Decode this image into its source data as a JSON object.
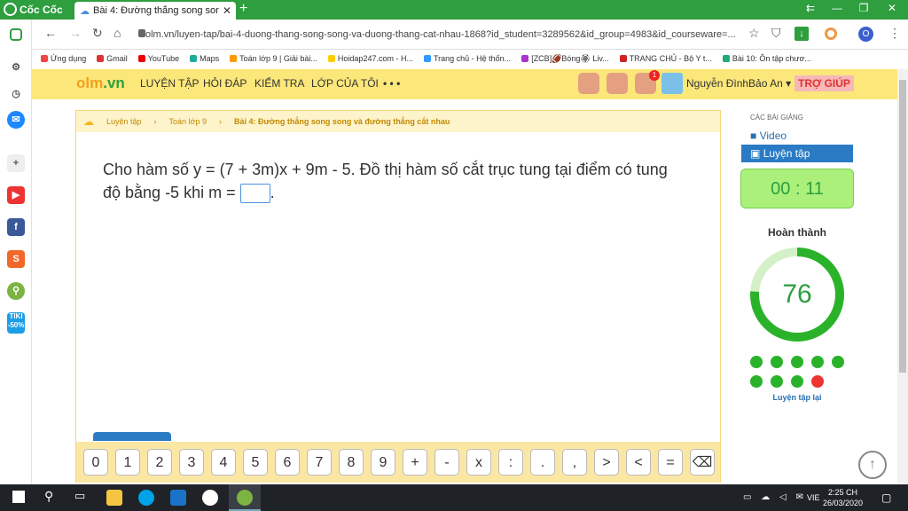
{
  "browser": {
    "app_name": "Cốc Cốc",
    "tab_title": "Bài 4: Đường thẳng song song",
    "url": "olm.vn/luyen-tap/bai-4-duong-thang-song-song-va-duong-thang-cat-nhau-1868?id_student=3289562&id_group=4983&id_courseware=...",
    "profile_initial": "O"
  },
  "bookmarks": [
    {
      "label": "Ứng dụng",
      "color": "#e44"
    },
    {
      "label": "Gmail",
      "color": "#d33"
    },
    {
      "label": "YouTube",
      "color": "#e00"
    },
    {
      "label": "Maps",
      "color": "#2a9"
    },
    {
      "label": "Toán lớp 9 | Giải bài...",
      "color": "#f90"
    },
    {
      "label": "Hoidap247.com - H...",
      "color": "#fc0"
    },
    {
      "label": "Trang chủ - Hệ thốn...",
      "color": "#39f"
    },
    {
      "label": "[ZCB]🏈Bóng🏵 Liv...",
      "color": "#a3c"
    },
    {
      "label": "TRANG CHỦ - Bộ Y t...",
      "color": "#c22"
    },
    {
      "label": "Bài 10: Ôn tập chươ...",
      "color": "#2a7"
    }
  ],
  "site": {
    "logo_main": "olm",
    "logo_suffix": ".vn",
    "menu": [
      "LUYỆN TẬP",
      "HỎI ĐÁP",
      "KIỂM TRA",
      "LỚP CỦA TÔI",
      "• • •"
    ],
    "notif_count": "1",
    "user_name": "Nguyễn ĐìnhBảo An ▾",
    "help": "TRỢ GIÚP"
  },
  "breadcrumb": [
    "Luyện tập",
    "Toán lớp 9",
    "Bài 4: Đường thẳng song song và đường thẳng cắt nhau"
  ],
  "question": {
    "text_line1": "Cho hàm số y = (7 + 3m)x + 9m - 5. Đồ thị hàm số cắt trục tung tại điểm có tung",
    "text_line2": "độ bằng -5 khi m =",
    "suffix": "."
  },
  "keypad": [
    "0",
    "1",
    "2",
    "3",
    "4",
    "5",
    "6",
    "7",
    "8",
    "9",
    "+",
    "-",
    "x",
    ":",
    ".",
    ",",
    ">",
    "<",
    "=",
    "⌫"
  ],
  "right_panel": {
    "section_title": "CÁC BÀI GIẢNG",
    "video": "Video",
    "practice": "Luyện tập",
    "timer": "00 : 11",
    "done_label": "Hoàn thành",
    "score": "76",
    "score_progress": 0.76,
    "result_dots": [
      "green",
      "green",
      "green",
      "green",
      "green",
      "green",
      "green",
      "green",
      "red"
    ],
    "retry": "Luyện tập lại"
  },
  "taskbar": {
    "lang": "VIE",
    "time": "2:25 CH",
    "date": "26/03/2020"
  }
}
